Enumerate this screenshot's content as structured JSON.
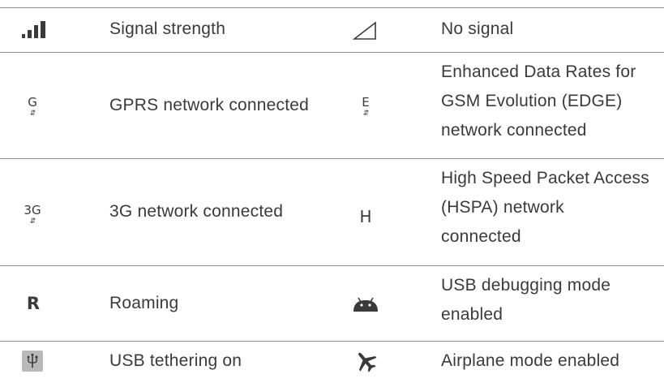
{
  "rows": [
    {
      "left_icon": "signal-strength-icon",
      "left_label": "Signal strength",
      "right_icon": "no-signal-icon",
      "right_label": [
        "No signal"
      ]
    },
    {
      "left_icon": "gprs-icon",
      "left_icon_letter": "G",
      "left_label": "GPRS network connected",
      "right_icon": "edge-icon",
      "right_icon_letter": "E",
      "right_label": [
        "Enhanced Data Rates for",
        "GSM Evolution (EDGE)",
        "network connected"
      ]
    },
    {
      "left_icon": "3g-icon",
      "left_icon_letter": "3G",
      "left_label": "3G network connected",
      "right_icon": "hspa-icon",
      "right_icon_letter": "H",
      "right_label": [
        "High Speed Packet Access",
        "(HSPA) network",
        "connected"
      ]
    },
    {
      "left_icon": "roaming-icon",
      "left_icon_letter": "R",
      "left_label": "Roaming",
      "right_icon": "usb-debugging-icon",
      "right_label": [
        "USB debugging mode",
        "enabled"
      ]
    },
    {
      "left_icon": "usb-tethering-icon",
      "left_label": "USB tethering on",
      "right_icon": "airplane-icon",
      "right_label": [
        "Airplane mode enabled"
      ]
    }
  ],
  "arrow_glyph": "⇵",
  "colors": {
    "text": "#3a3a3a",
    "rule": "#8c8c8c",
    "icon_bg": "#b9b9b9"
  }
}
